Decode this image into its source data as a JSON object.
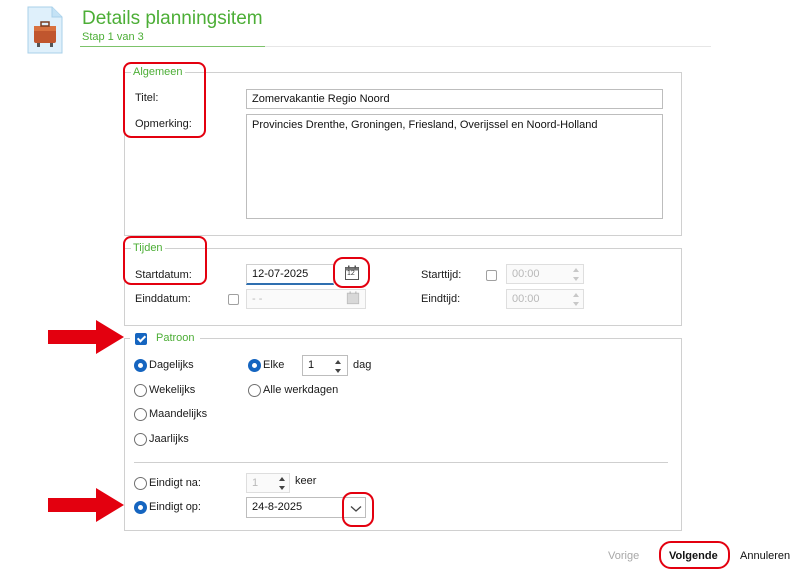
{
  "header": {
    "title": "Details planningsitem",
    "step": "Stap 1 van 3"
  },
  "general": {
    "group_label": "Algemeen",
    "title_label": "Titel:",
    "title_value": "Zomervakantie Regio Noord",
    "remark_label": "Opmerking:",
    "remark_value": "Provincies Drenthe, Groningen, Friesland, Overijssel en Noord-Holland"
  },
  "times": {
    "group_label": "Tijden",
    "start_date_label": "Startdatum:",
    "start_date_value": "12-07-2025",
    "calendar_day": "12",
    "end_date_label": "Einddatum:",
    "end_date_value": "- -",
    "start_time_label": "Starttijd:",
    "start_time_value": "00:00",
    "end_time_label": "Eindtijd:",
    "end_time_value": "00:00"
  },
  "pattern": {
    "group_label": "Patroon",
    "enabled": true,
    "frequencies": [
      "Dagelijks",
      "Wekelijks",
      "Maandelijks",
      "Jaarlijks"
    ],
    "selected_frequency": "Dagelijks",
    "every_label": "Elke",
    "every_value": "1",
    "every_unit": "dag",
    "workdays_label": "Alle werkdagen",
    "ends_after_label": "Eindigt na:",
    "ends_after_value": "1",
    "ends_after_unit": "keer",
    "ends_on_label": "Eindigt op:",
    "ends_on_value": "24-8-2025"
  },
  "footer": {
    "prev_label": "Vorige",
    "next_label": "Volgende",
    "cancel_label": "Annuleren"
  },
  "colors": {
    "accent_green": "#4cae36",
    "highlight_red": "#e3000f",
    "checkbox_blue": "#1565c0"
  }
}
